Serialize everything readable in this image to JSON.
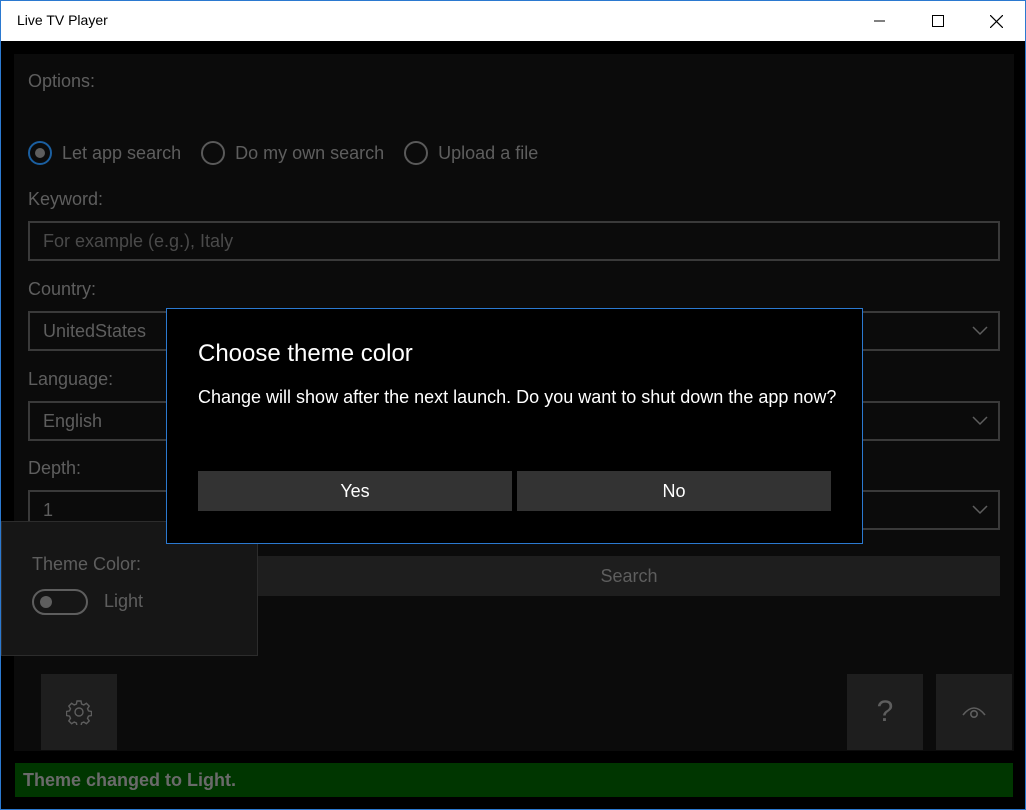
{
  "window": {
    "title": "Live TV Player",
    "controls": {
      "minimize": "minimize-icon",
      "maximize": "maximize-icon",
      "close": "close-icon"
    }
  },
  "options": {
    "label": "Options:",
    "radios": [
      {
        "label": "Let app search",
        "checked": true
      },
      {
        "label": "Do my own search",
        "checked": false
      },
      {
        "label": "Upload a file",
        "checked": false
      }
    ]
  },
  "keyword": {
    "label": "Keyword:",
    "value": "",
    "placeholder": "For example (e.g.), Italy"
  },
  "country": {
    "label": "Country:",
    "value": "UnitedStates"
  },
  "language": {
    "label": "Language:",
    "value": "English"
  },
  "depth": {
    "label": "Depth:",
    "value": "1"
  },
  "search_button": "Search",
  "theme": {
    "label": "Theme Color:",
    "toggle_state": "Light",
    "on": false
  },
  "icons": {
    "settings": "gear-icon",
    "help": "?",
    "preview": "eye-icon"
  },
  "status": "Theme changed to Light.",
  "dialog": {
    "title": "Choose theme color",
    "message": "Change will show after the next launch. Do you want to shut down the app now?",
    "yes": "Yes",
    "no": "No"
  },
  "colors": {
    "accent": "#2b79d0",
    "radio_checked_ring": "#1b5fa0",
    "status_bar_bg": "#003600",
    "dialog_button_bg": "#333333"
  }
}
